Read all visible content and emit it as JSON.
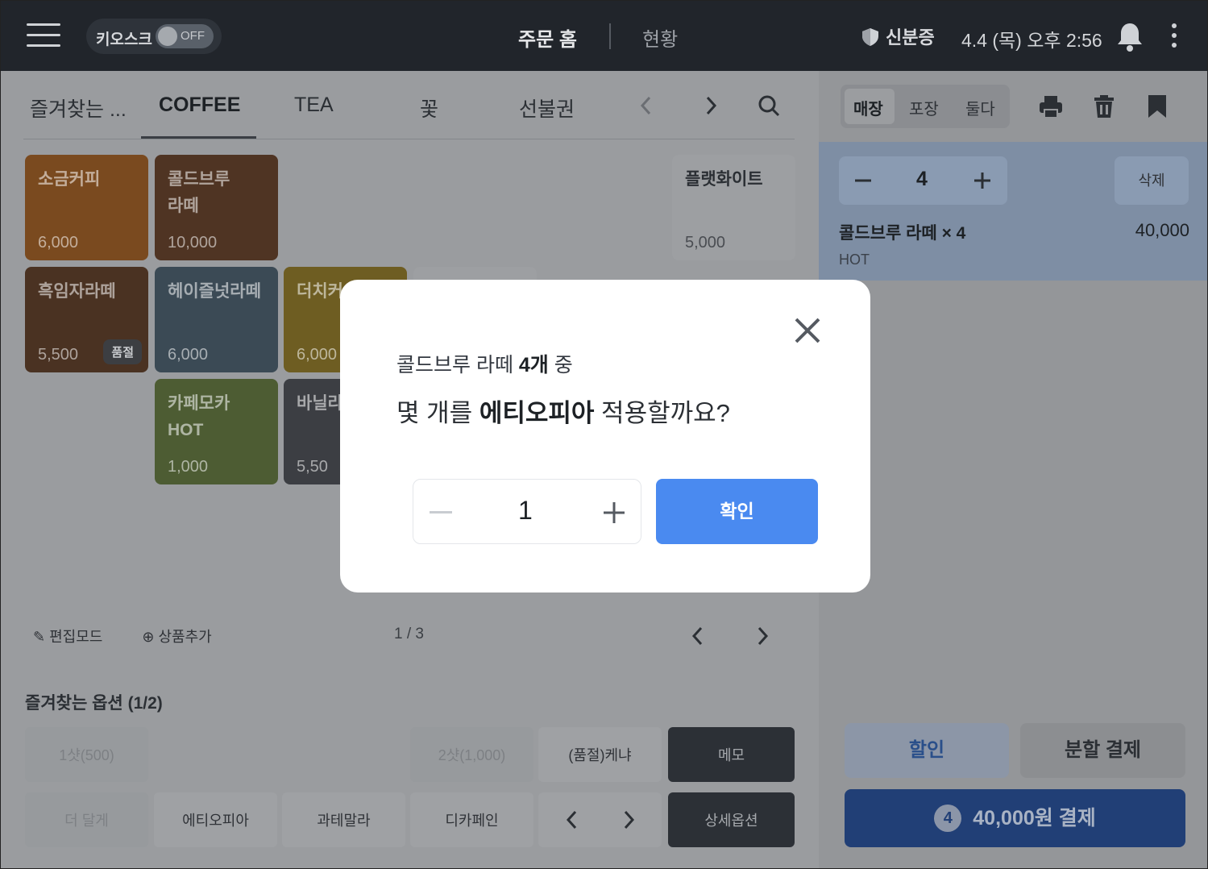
{
  "topbar": {
    "kiosk_label": "키오스크",
    "kiosk_toggle": "OFF",
    "nav_home": "주문 홈",
    "nav_status": "현황",
    "id_card": "신분증",
    "datetime": "4.4 (목) 오후 2:56"
  },
  "tabs": [
    "즐겨찾는 ...",
    "COFFEE",
    "TEA",
    "꽃",
    "선불권"
  ],
  "products": [
    {
      "name": "소금커피",
      "price": "6,000",
      "color": "#7a4a1f"
    },
    {
      "name": "콜드브루 라떼",
      "price": "10,000",
      "color": "#4f3423"
    },
    {
      "name": "플랫화이트",
      "price": "5,000",
      "color": "#9a9c9f"
    },
    {
      "name": "흑임자라떼",
      "price": "5,500",
      "color": "#4a3222",
      "sold_out": "품절"
    },
    {
      "name": "헤이즐넛라떼",
      "price": "6,000",
      "color": "#3b4a55"
    },
    {
      "name": "더치커",
      "price": "6,000",
      "color": "#6e5d22"
    },
    {
      "name": "카페모카 HOT",
      "price": "1,000",
      "color": "#4d5c33"
    },
    {
      "name": "바닐라",
      "price": "5,50",
      "color": "#3c3e43"
    }
  ],
  "edit_mode": "편집모드",
  "add_product": "상품추가",
  "pager": "1 / 3",
  "fav_options_title": "즐겨찾는 옵션 (1/2)",
  "options_row1": [
    "1샷(500)",
    "2샷(1,000)",
    "(품절)케냐",
    "메모"
  ],
  "options_row2": [
    "더 달게",
    "에티오피아",
    "과테말라",
    "디카페인",
    "상세옵션"
  ],
  "order_types": [
    "매장",
    "포장",
    "둘다"
  ],
  "cart": {
    "qty": "4",
    "delete": "삭제",
    "item_name": "콜드브루 라떼 × 4",
    "item_price": "40,000",
    "item_option": "HOT"
  },
  "buttons": {
    "discount": "할인",
    "split": "분할 결제",
    "pay_count": "4",
    "pay_label": "40,000원 결제"
  },
  "modal": {
    "sub_prefix": "콜드브루 라떼",
    "sub_count": "4개",
    "sub_suffix": "중",
    "question_prefix": "몇 개를",
    "question_bold": "에티오피아",
    "question_suffix": "적용할까요?",
    "value": "1",
    "confirm": "확인"
  }
}
